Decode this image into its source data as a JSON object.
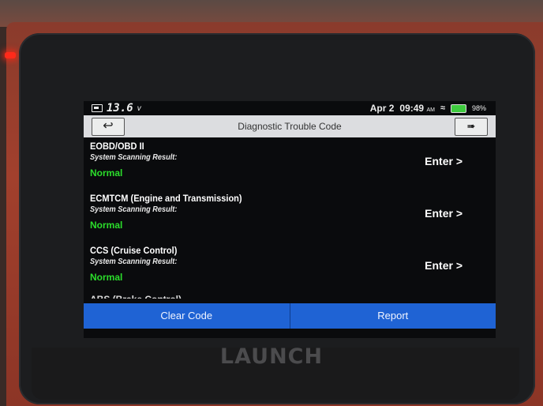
{
  "status_bar": {
    "voltage": "13.6",
    "voltage_unit": "v",
    "date": "Apr 2",
    "time": "09:49",
    "ampm": "AM",
    "battery_percent": "98%",
    "wifi_icon": "wifi-icon"
  },
  "title_bar": {
    "title": "Diagnostic Trouble Code",
    "back_icon": "back-arrow-icon",
    "exit_icon": "exit-icon"
  },
  "systems": [
    {
      "name": "EOBD/OBD II",
      "subtitle": "System Scanning Result:",
      "result": "Normal",
      "action": "Enter >"
    },
    {
      "name": "ECMTCM (Engine and Transmission)",
      "subtitle": "System Scanning Result:",
      "result": "Normal",
      "action": "Enter >"
    },
    {
      "name": "CCS (Cruise Control)",
      "subtitle": "System Scanning Result:",
      "result": "Normal",
      "action": "Enter >"
    },
    {
      "name": "ABS (Brake Control)"
    }
  ],
  "bottom_bar": {
    "clear_code_label": "Clear Code",
    "report_label": "Report"
  },
  "device": {
    "brand": "LAUNCH"
  },
  "colors": {
    "result_ok": "#2bdd2b",
    "bottom_bar": "#1f63d4",
    "title_bar": "#dcdde0",
    "device_body": "#a2402d"
  }
}
